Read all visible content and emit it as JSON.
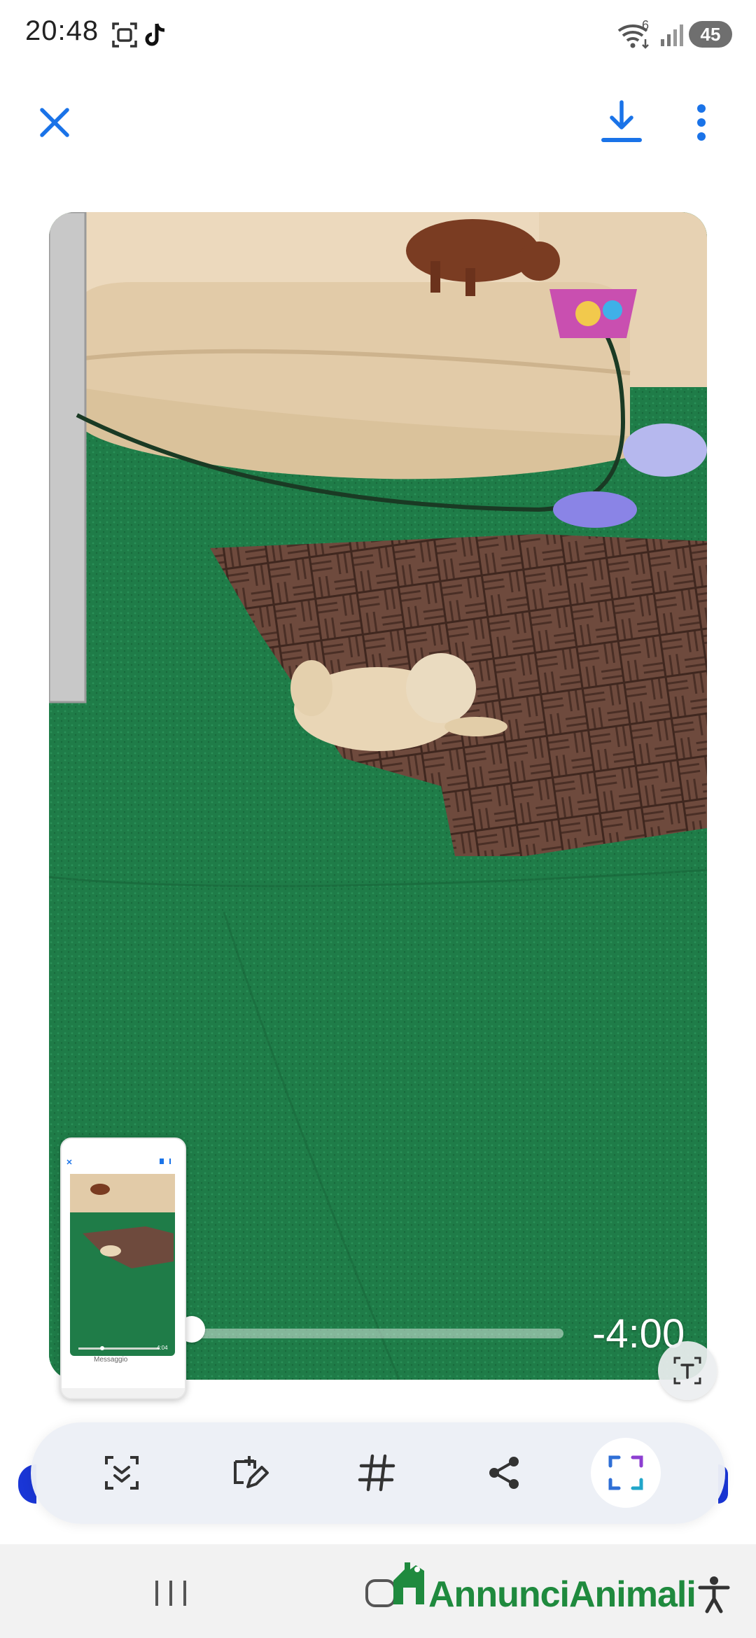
{
  "status_bar": {
    "time": "20:48",
    "battery": "45",
    "network_badge": "6"
  },
  "top_bar": {
    "close_icon": "close-icon",
    "download_icon": "download-icon",
    "more_icon": "more-vert-icon",
    "accent_color": "#1a73e8"
  },
  "video": {
    "remaining_time": "-4:00",
    "progress": 0.13
  },
  "thumbnail": {
    "message_placeholder": "Messaggio",
    "remaining_time": "4:04"
  },
  "toolbar": {
    "items": [
      {
        "icon": "smart-select-icon"
      },
      {
        "icon": "draw-crop-icon"
      },
      {
        "icon": "hashtag-icon"
      },
      {
        "icon": "share-icon"
      },
      {
        "icon": "capture-frame-icon"
      }
    ]
  },
  "nav": {
    "brand": "AnnunciAnimali",
    "brand_color": "#1f8a3e"
  }
}
